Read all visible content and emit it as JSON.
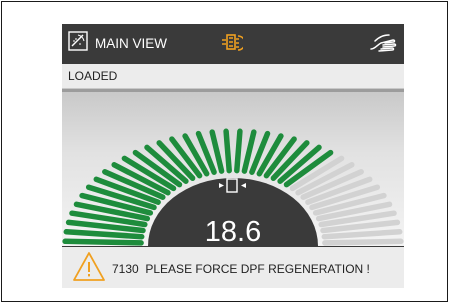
{
  "header": {
    "title": "MAIN VIEW",
    "left_icon": "gauge-settings-icon",
    "center_icon": "dpf-regeneration-icon",
    "right_icon": "hand-icon"
  },
  "status": {
    "text": "LOADED"
  },
  "gauge": {
    "value": "18.6",
    "fill_fraction": 0.7,
    "icon": "dpf-filter-icon",
    "colors": {
      "active": "#1e8c3c",
      "inactive": "#d2d2d2",
      "hub": "#3a3a3a",
      "accent": "#f0a020"
    }
  },
  "alert": {
    "icon": "warning-icon",
    "code": "7130",
    "message": "PLEASE FORCE DPF REGENERATION !"
  }
}
